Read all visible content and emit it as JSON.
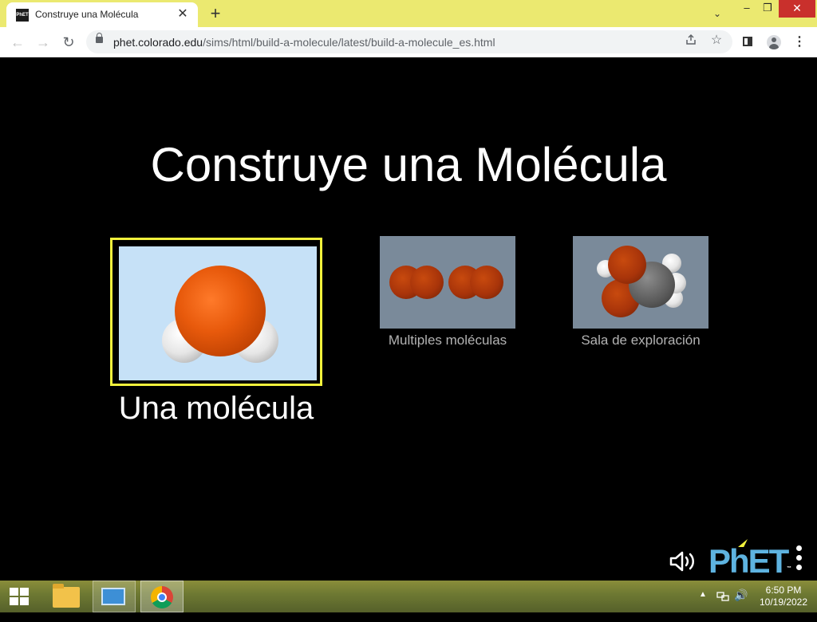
{
  "browser": {
    "tab": {
      "favicon_text": "PhET",
      "title": "Construye una Molécula",
      "close": "✕"
    },
    "new_tab": "+",
    "tab_search": "⌄",
    "window": {
      "minimize": "–",
      "restore": "❐",
      "close": "✕"
    },
    "nav": {
      "back": "←",
      "forward": "→",
      "reload": "↻"
    },
    "url": {
      "host": "phet.colorado.edu",
      "path": "/sims/html/build-a-molecule/latest/build-a-molecule_es.html"
    },
    "menu": "⋮"
  },
  "sim": {
    "title": "Construye una Molécula",
    "screens": [
      {
        "label": "Una molécula",
        "selected": true
      },
      {
        "label": "Multiples moléculas",
        "selected": false
      },
      {
        "label": "Sala de exploración",
        "selected": false
      }
    ],
    "logo": "PhET",
    "trademark": "™"
  },
  "taskbar": {
    "time": "6:50 PM",
    "date": "10/19/2022",
    "tray_arrow": "▲",
    "volume": "🔊"
  },
  "colors": {
    "tab_strip": "#ebe970",
    "selection_border": "#f2f23c",
    "phet_blue": "#5eb3e0",
    "oxygen": "#e85a0c",
    "thumb_bg": "#c6e1f7"
  }
}
